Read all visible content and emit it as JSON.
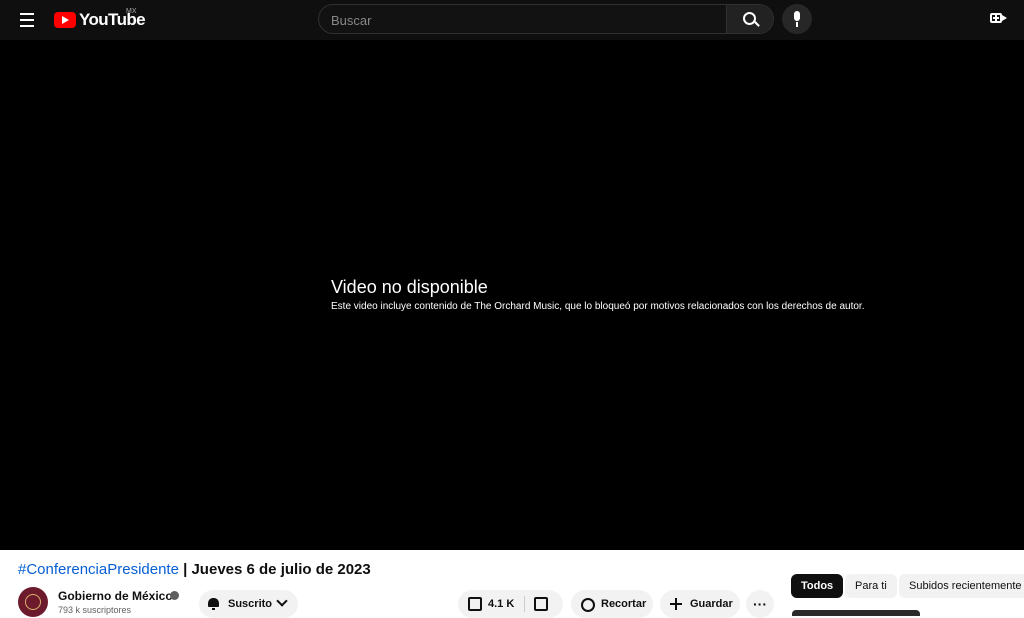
{
  "header": {
    "logo_text": "YouTube",
    "country_code": "MX",
    "search_placeholder": "Buscar",
    "icons": [
      "menu-icon",
      "youtube-logo-icon",
      "search-icon",
      "mic-icon",
      "create-video-icon"
    ]
  },
  "player": {
    "error_title": "Video no disponible",
    "error_message": "Este video incluye contenido de The Orchard Music, que lo bloqueó por motivos relacionados con los derechos de autor."
  },
  "video": {
    "title_hashtag": "#ConferenciaPresidente",
    "title_rest": " | Jueves 6 de julio de 2023"
  },
  "channel": {
    "name": "Gobierno de México",
    "subscribers": "793 k suscriptores",
    "subscribe_label": "Suscrito"
  },
  "actions": {
    "likes": "4.1 K",
    "clip_label": "Recortar",
    "save_label": "Guardar",
    "more_label": "···"
  },
  "chips": [
    "Todos",
    "Para ti",
    "Subidos recientemente"
  ],
  "colors": {
    "topbar_bg": "#0f0f0f",
    "player_bg": "#000000",
    "brand_red": "#ff0000",
    "link_blue": "#065fd4"
  }
}
